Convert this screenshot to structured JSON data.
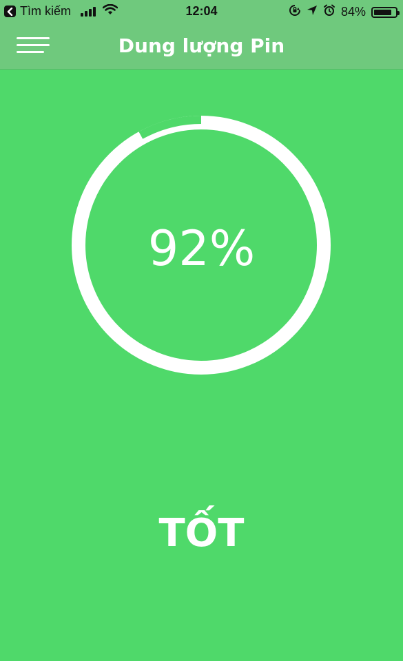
{
  "status_bar": {
    "back_label": "Tìm kiếm",
    "time": "12:04",
    "battery_percent_label": "84%",
    "battery_level": 0.84,
    "icons": [
      "back-arrow-icon",
      "signal-icon",
      "wifi-icon",
      "rotation-lock-icon",
      "location-icon",
      "alarm-icon",
      "battery-icon"
    ]
  },
  "header": {
    "title": "Dung lượng Pin",
    "menu_icon": "hamburger-menu-icon"
  },
  "gauge": {
    "value": 92,
    "value_label": "92%"
  },
  "status": {
    "label": "TỐT"
  },
  "colors": {
    "background": "#4fd96a",
    "header": "#6fc97d",
    "ring": "#ffffff"
  }
}
